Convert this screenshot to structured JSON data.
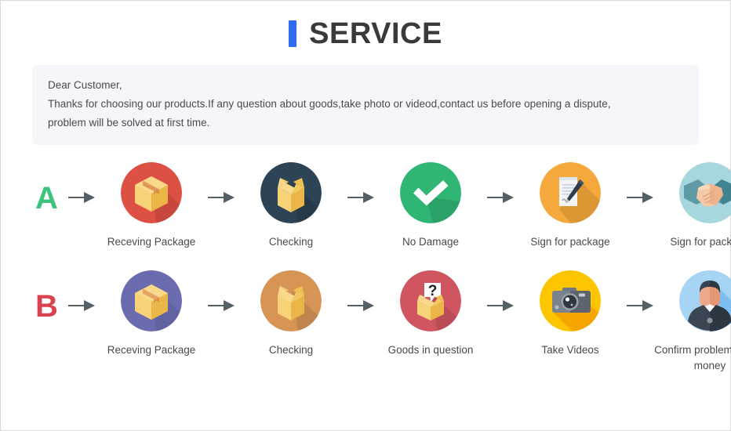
{
  "page": {
    "title": "SERVICE",
    "accent_color": "#2f6bf0",
    "background": "#ffffff"
  },
  "notice": {
    "line1": "Dear Customer,",
    "line2": "Thanks for choosing our products.If any question about goods,take photo or videod,contact us before opening a dispute,",
    "line3": "problem will be solved at first time.",
    "background": "#f5f6fa"
  },
  "rows": [
    {
      "letter": "A",
      "letter_color": "#3cc47c",
      "steps": [
        {
          "label": "Receving Package",
          "icon": "closed-box-icon",
          "circle_color": "#dd5044"
        },
        {
          "label": "Checking",
          "icon": "open-box-icon",
          "circle_color": "#2d4356"
        },
        {
          "label": "No Damage",
          "icon": "check-mark-icon",
          "circle_color": "#2fb574"
        },
        {
          "label": "Sign for package",
          "icon": "document-pen-icon",
          "circle_color": "#f5a93c"
        },
        {
          "label": "Sign for package",
          "icon": "handshake-icon",
          "circle_color": "#a6d6de"
        }
      ]
    },
    {
      "letter": "B",
      "letter_color": "#d8434f",
      "steps": [
        {
          "label": "Receving Package",
          "icon": "closed-box-icon",
          "circle_color": "#6b6cb0"
        },
        {
          "label": "Checking",
          "icon": "open-box-icon",
          "circle_color": "#d69555"
        },
        {
          "label": "Goods in question",
          "icon": "question-box-icon",
          "circle_color": "#cf5560"
        },
        {
          "label": "Take Videos",
          "icon": "camera-icon",
          "circle_color": "#fdc500"
        },
        {
          "label": "Confirm problem,refund money",
          "icon": "person-avatar-icon",
          "circle_color": "#a5d4f5"
        }
      ]
    }
  ],
  "arrow": {
    "icon": "arrow-right-icon",
    "color": "#555f66"
  }
}
